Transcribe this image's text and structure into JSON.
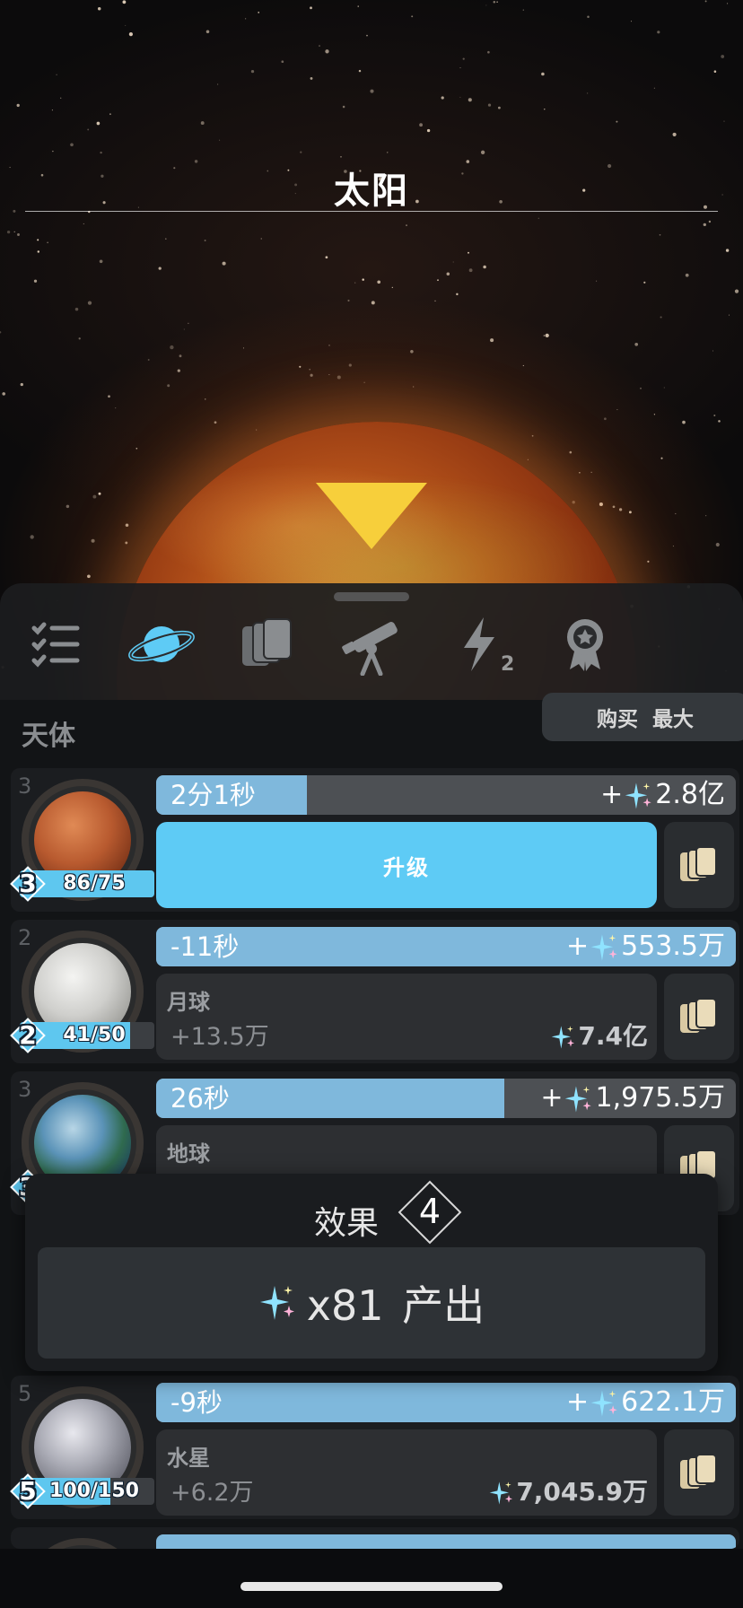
{
  "header": {
    "title": "太阳"
  },
  "tabs": [
    {
      "icon": "checklist-icon"
    },
    {
      "icon": "planet-icon",
      "active": true
    },
    {
      "icon": "cards-icon"
    },
    {
      "icon": "telescope-icon"
    },
    {
      "icon": "lightning-icon",
      "badge": "2"
    },
    {
      "icon": "award-ribbon-icon"
    }
  ],
  "list": {
    "section_title": "天体",
    "buy_label": "购买 最大",
    "rows": [
      {
        "count": "3",
        "planet": "mars-planet",
        "level": "3",
        "level_progress": "86/75",
        "level_fill": 1.0,
        "timer": "2分1秒",
        "timer_fill": 0.26,
        "yield": "2.8亿",
        "yield_prefix": "+",
        "action": "升级"
      },
      {
        "count": "2",
        "planet": "moon",
        "level": "2",
        "level_progress": "41/50",
        "level_fill": 0.82,
        "timer": "-11秒",
        "timer_fill": 1.0,
        "yield": "553.5万",
        "yield_prefix": "+",
        "name": "月球",
        "rate": "+13.5万",
        "total": "7.4亿"
      },
      {
        "count": "3",
        "planet": "earth",
        "level": "3",
        "timer": "26秒",
        "timer_fill": 0.6,
        "yield": "1,975.5万",
        "yield_prefix": "+",
        "name": "地球"
      },
      {
        "count": "5",
        "planet": "mercury",
        "level": "5",
        "level_progress": "100/150",
        "level_fill": 0.67,
        "timer": "-9秒",
        "timer_fill": 1.0,
        "yield": "622.1万",
        "yield_prefix": "+",
        "name": "水星",
        "rate": "+6.2万",
        "total": "7,045.9万"
      }
    ]
  },
  "popup": {
    "title": "效果",
    "level": "4",
    "effect": "x81 产出"
  },
  "colors": {
    "accent": "#5ecbf5",
    "timer_fill": "#7fb8dc",
    "marker": "#f7cf3b"
  }
}
